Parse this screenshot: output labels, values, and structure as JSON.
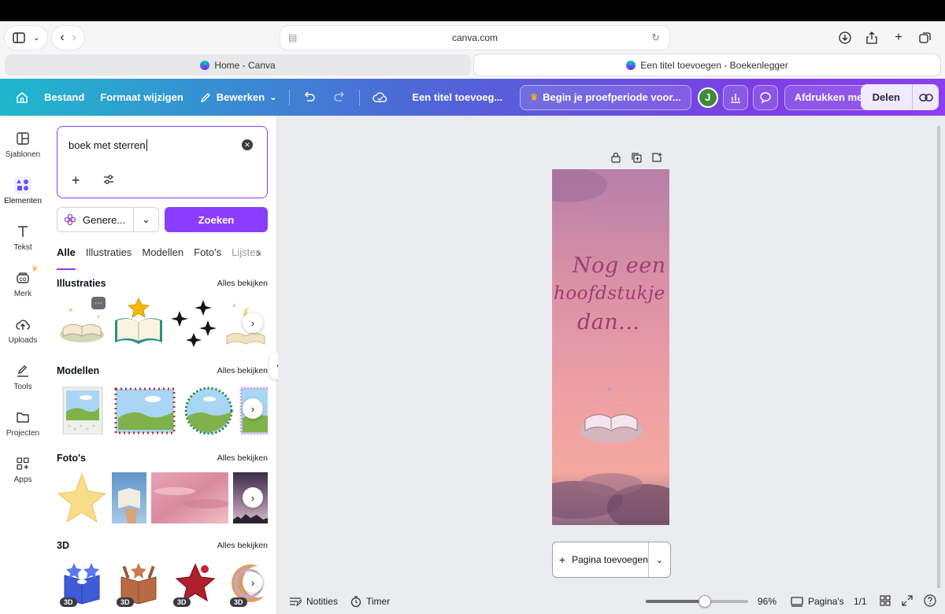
{
  "browser": {
    "url": "canva.com",
    "tabs": [
      {
        "label": "Home - Canva",
        "active": false
      },
      {
        "label": "Een titel toevoegen - Boekenlegger",
        "active": true
      }
    ]
  },
  "header": {
    "file": "Bestand",
    "resize": "Formaat wijzigen",
    "edit": "Bewerken",
    "title": "Een titel toevoeg...",
    "trial": "Begin je proefperiode voor...",
    "avatar_initial": "J",
    "print": "Afdrukken met Canva",
    "share": "Delen"
  },
  "rail": {
    "items": [
      {
        "label": "Sjablonen",
        "icon": "templates-icon"
      },
      {
        "label": "Elementen",
        "icon": "elements-icon"
      },
      {
        "label": "Tekst",
        "icon": "text-icon"
      },
      {
        "label": "Merk",
        "icon": "brand-icon"
      },
      {
        "label": "Uploads",
        "icon": "uploads-icon"
      },
      {
        "label": "Tools",
        "icon": "tools-icon"
      },
      {
        "label": "Projecten",
        "icon": "projects-icon"
      },
      {
        "label": "Apps",
        "icon": "apps-icon"
      }
    ]
  },
  "panel": {
    "search_value": "boek met sterren",
    "generate_label": "Genere...",
    "search_button": "Zoeken",
    "filter_tabs": [
      "Alle",
      "Illustraties",
      "Modellen",
      "Foto's",
      "Lijsten"
    ],
    "see_all": "Alles bekijken",
    "sections": [
      "Illustraties",
      "Modellen",
      "Foto's",
      "3D"
    ],
    "badge_3d": "3D"
  },
  "canvas": {
    "bookmark_lines": [
      "Nog een",
      "hoofdstukje",
      "dan..."
    ],
    "add_page": "Pagina toevoegen"
  },
  "bottombar": {
    "notes": "Notities",
    "timer": "Timer",
    "zoom": "96%",
    "zoom_fraction": 0.58,
    "pages_label": "Pagina's",
    "page_count": "1/1"
  },
  "colors": {
    "accent": "#8b3dff",
    "bookmark_text": "#9e3b74"
  }
}
